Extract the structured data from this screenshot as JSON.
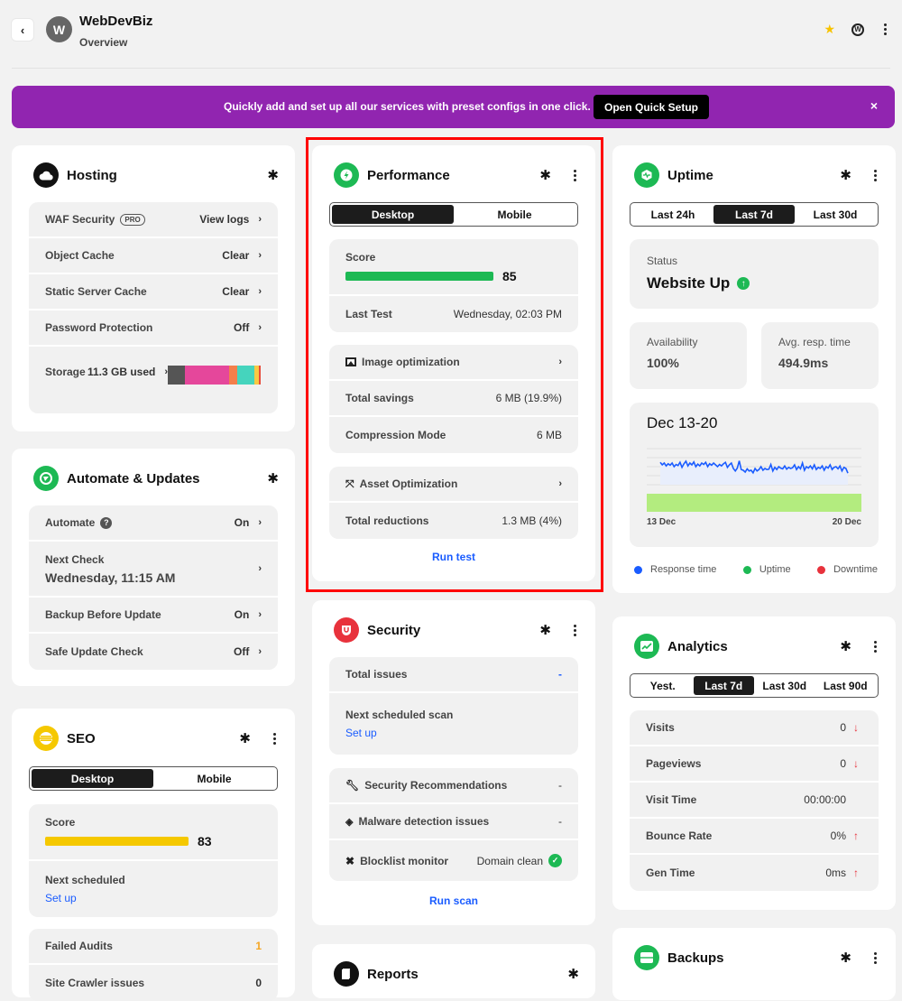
{
  "header": {
    "back_label": "‹",
    "avatar_letter": "W",
    "site_name": "WebDevBiz",
    "subtitle": "Overview",
    "star_glyph": "★",
    "wp_glyph": "W"
  },
  "banner": {
    "text": "Quickly add and set up all our services with preset configs in one click.",
    "button": "Open Quick Setup",
    "close": "×",
    "color": "#9125b0"
  },
  "hosting": {
    "title": "Hosting",
    "rows": [
      {
        "label": "WAF Security",
        "badge": "PRO",
        "value": "View logs"
      },
      {
        "label": "Object Cache",
        "value": "Clear"
      },
      {
        "label": "Static Server Cache",
        "value": "Clear"
      },
      {
        "label": "Password Protection",
        "value": "Off"
      },
      {
        "label": "Storage",
        "value": "11.3 GB used"
      }
    ],
    "storage_segments": [
      {
        "color": "#555555",
        "fraction": 0.18
      },
      {
        "color": "#e5479b",
        "fraction": 0.47
      },
      {
        "color": "#f47f4b",
        "fraction": 0.09
      },
      {
        "color": "#45d4bd",
        "fraction": 0.18
      },
      {
        "color": "#f9c943",
        "fraction": 0.05
      },
      {
        "color": "#e74c3c",
        "fraction": 0.02
      }
    ]
  },
  "automate": {
    "title": "Automate & Updates",
    "rows": [
      {
        "label": "Automate",
        "value": "On"
      },
      {
        "label": "Next Check",
        "sub": "Wednesday, 11:15 AM"
      },
      {
        "label": "Backup Before Update",
        "value": "On"
      },
      {
        "label": "Safe Update Check",
        "value": "Off"
      }
    ]
  },
  "seo": {
    "title": "SEO",
    "tabs": [
      "Desktop",
      "Mobile"
    ],
    "active_tab": 0,
    "score_label": "Score",
    "score": 83,
    "score_color": "#f5c800",
    "next_label": "Next scheduled",
    "next_link": "Set up",
    "rows": [
      {
        "label": "Failed Audits",
        "value": "1"
      },
      {
        "label": "Site Crawler issues",
        "value": "0"
      }
    ]
  },
  "performance": {
    "title": "Performance",
    "tabs": [
      "Desktop",
      "Mobile"
    ],
    "active_tab": 0,
    "score_label": "Score",
    "score": 85,
    "score_color": "#1db954",
    "last_test_label": "Last Test",
    "last_test": "Wednesday, 02:03 PM",
    "image_opt": {
      "label": "Image optimization",
      "rows": [
        {
          "label": "Total savings",
          "value": "6 MB (19.9%)"
        },
        {
          "label": "Compression Mode",
          "value": "6 MB"
        }
      ]
    },
    "asset_opt": {
      "label": "Asset Optimization",
      "rows": [
        {
          "label": "Total reductions",
          "value": "1.3 MB (4%)"
        }
      ]
    },
    "action": "Run test"
  },
  "security": {
    "title": "Security",
    "total_issues_label": "Total issues",
    "total_issues": "-",
    "next_scan_label": "Next scheduled scan",
    "next_scan_link": "Set up",
    "rows": [
      {
        "label": "Security Recommendations",
        "value": "-"
      },
      {
        "label": "Malware detection issues",
        "value": "-"
      },
      {
        "label": "Blocklist monitor",
        "value": "Domain clean"
      }
    ],
    "action": "Run scan"
  },
  "reports": {
    "title": "Reports"
  },
  "uptime": {
    "title": "Uptime",
    "tabs": [
      "Last 24h",
      "Last 7d",
      "Last 30d"
    ],
    "active_tab": 1,
    "status_label": "Status",
    "status": "Website Up",
    "availability_label": "Availability",
    "availability": "100%",
    "resp_label": "Avg. resp. time",
    "resp": "494.9ms",
    "chart_title": "Dec 13-20",
    "x_start": "13 Dec",
    "x_end": "20 Dec",
    "legend": [
      {
        "label": "Response time",
        "color": "#1a5cff"
      },
      {
        "label": "Uptime",
        "color": "#1db954"
      },
      {
        "label": "Downtime",
        "color": "#e8323c"
      }
    ],
    "response_series": [
      0.62,
      0.55,
      0.6,
      0.52,
      0.58,
      0.54,
      0.6,
      0.5,
      0.56,
      0.53,
      0.62,
      0.48,
      0.58,
      0.65,
      0.52,
      0.6,
      0.55,
      0.63,
      0.5,
      0.57,
      0.52,
      0.6,
      0.56,
      0.62,
      0.5,
      0.58,
      0.54,
      0.6,
      0.55,
      0.5,
      0.56,
      0.52,
      0.58,
      0.62,
      0.48,
      0.55,
      0.6,
      0.45,
      0.38,
      0.46,
      0.66,
      0.42,
      0.4,
      0.35,
      0.44,
      0.38,
      0.4,
      0.33,
      0.45,
      0.38,
      0.42,
      0.5,
      0.4,
      0.45,
      0.42,
      0.43,
      0.56,
      0.38,
      0.48,
      0.42,
      0.5,
      0.46,
      0.44,
      0.52,
      0.43,
      0.48,
      0.45,
      0.47,
      0.55,
      0.42,
      0.5,
      0.44,
      0.6,
      0.4,
      0.5,
      0.46,
      0.52,
      0.44,
      0.55,
      0.42,
      0.48,
      0.45,
      0.52,
      0.4,
      0.5,
      0.46,
      0.55,
      0.42,
      0.48,
      0.5,
      0.44,
      0.52,
      0.38,
      0.48,
      0.45,
      0.32
    ]
  },
  "analytics": {
    "title": "Analytics",
    "tabs": [
      "Yest.",
      "Last 7d",
      "Last 30d",
      "Last 90d"
    ],
    "active_tab": 1,
    "rows": [
      {
        "label": "Visits",
        "value": "0",
        "trend": "down"
      },
      {
        "label": "Pageviews",
        "value": "0",
        "trend": "down"
      },
      {
        "label": "Visit Time",
        "value": "00:00:00",
        "trend": ""
      },
      {
        "label": "Bounce Rate",
        "value": "0%",
        "trend": "up"
      },
      {
        "label": "Gen Time",
        "value": "0ms",
        "trend": "up"
      }
    ]
  },
  "backups": {
    "title": "Backups"
  },
  "shared": {
    "chevron": "›",
    "gear": "✱",
    "help": "?",
    "arrow_down": "↓",
    "arrow_up": "↑",
    "check": "✓"
  }
}
